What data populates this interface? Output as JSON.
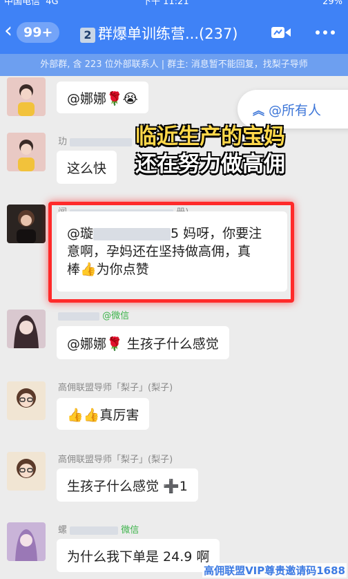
{
  "status_bar": {
    "carrier": "中国电信",
    "network": "4G",
    "time": "下午 11:21",
    "battery": "29%"
  },
  "nav": {
    "back_chevron": "‹",
    "unread_count": "99+",
    "title_number": "2",
    "title": "群爆单训练营...(237)"
  },
  "info_bar": {
    "text": "外部群, 含 223 位外部联系人 | 群主: 消息暂不能回复，找梨子导师"
  },
  "mention_pill": {
    "chevron": "︽",
    "label": "@所有人"
  },
  "overlay_caption": {
    "line1": "临近生产的宝妈",
    "line2": "还在努力做高佣"
  },
  "messages": [
    {
      "sender": "",
      "text": "@娜娜🌹😭"
    },
    {
      "sender": "玏",
      "text": "这么快"
    },
    {
      "sender_prefix": "闻",
      "sender_suffix": "册)",
      "line1_prefix": "@璇",
      "line1_suffix": "5 妈呀，你要注",
      "line2": "意啊，孕妈还在坚持做高佣，真",
      "line3": "棒👍为你点赞"
    },
    {
      "sender_wechat": "@微信",
      "text": "@娜娜🌹 生孩子什么感觉"
    },
    {
      "sender": "高佣联盟导师「梨子」(梨子)",
      "text": "👍👍真厉害"
    },
    {
      "sender": "高佣联盟导师「梨子」(梨子)",
      "text": "生孩子什么感觉 ➕1"
    },
    {
      "sender_prefix": "螺",
      "sender_wechat": "微信",
      "text": "为什么我下单是 24.9 啊"
    }
  ],
  "watermark": {
    "text": "高佣联盟VIP尊贵邀请码1688"
  },
  "colors": {
    "accent": "#3f82f6",
    "highlight": "#ff2a2a",
    "caption_yellow": "#ffd84a",
    "wechat_green": "#3cb34a"
  }
}
